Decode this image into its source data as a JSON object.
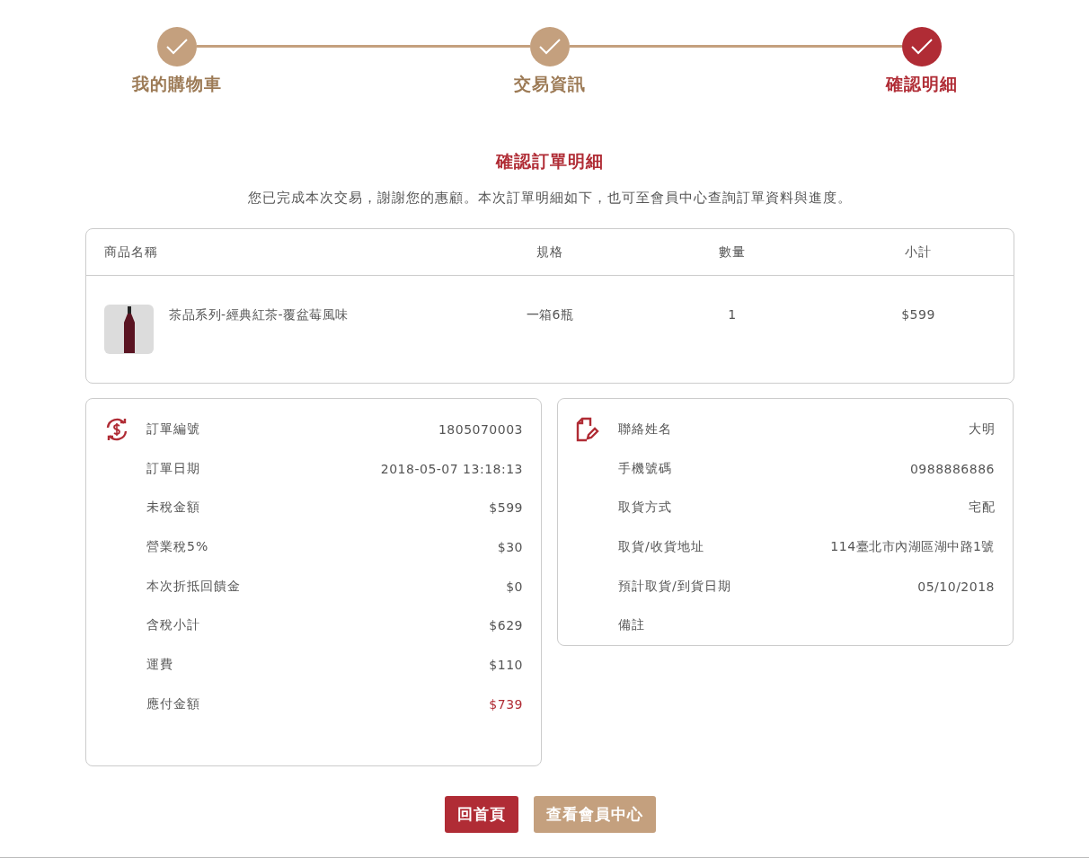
{
  "steps": [
    {
      "label": "我的購物車",
      "current": false
    },
    {
      "label": "交易資訊",
      "current": false
    },
    {
      "label": "確認明細",
      "current": true
    }
  ],
  "title": "確認訂單明細",
  "message": "您已完成本次交易，謝謝您的惠顧。本次訂單明細如下，也可至會員中心查詢訂單資料與進度。",
  "table": {
    "columns": [
      "商品名稱",
      "規格",
      "數量",
      "小計"
    ],
    "rows": [
      {
        "name": "茶品系列-經典紅茶-覆盆莓風味",
        "spec": "一箱6瓶",
        "qty": "1",
        "subtotal": "$599"
      }
    ]
  },
  "order_card": {
    "rows": [
      {
        "label": "訂單編號",
        "value": "1805070003",
        "highlight": false
      },
      {
        "label": "訂單日期",
        "value": "2018-05-07 13:18:13",
        "highlight": false
      },
      {
        "label": "未稅金額",
        "value": "$599",
        "highlight": false
      },
      {
        "label": "營業稅5%",
        "value": "$30",
        "highlight": false
      },
      {
        "label": "本次折抵回饋金",
        "value": "$0",
        "highlight": false
      },
      {
        "label": "含稅小計",
        "value": "$629",
        "highlight": false
      },
      {
        "label": "運費",
        "value": "$110",
        "highlight": false
      },
      {
        "label": "應付金額",
        "value": "$739",
        "highlight": true
      }
    ]
  },
  "contact_card": {
    "rows": [
      {
        "label": "聯絡姓名",
        "value": "大明"
      },
      {
        "label": "手機號碼",
        "value": "0988886886"
      },
      {
        "label": "取貨方式",
        "value": "宅配"
      },
      {
        "label": "取貨/收貨地址",
        "value": "114臺北市內湖區湖中路1號"
      },
      {
        "label": "預計取貨/到貨日期",
        "value": "05/10/2018"
      },
      {
        "label": "備註"
      }
    ]
  },
  "buttons": [
    {
      "label": "回首頁",
      "kind": "primary"
    },
    {
      "label": "查看會員中心",
      "kind": "secondary"
    }
  ]
}
